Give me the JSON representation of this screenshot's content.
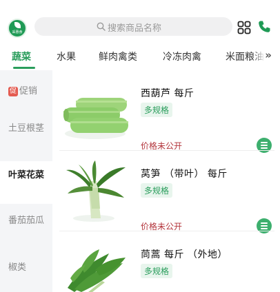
{
  "header": {
    "logo_text": "采惠食",
    "search_placeholder": "搜索商品名称",
    "icons": [
      "scan-grid-icon",
      "phone-icon",
      "search-icon"
    ]
  },
  "tabs": [
    {
      "label": "蔬菜",
      "active": true
    },
    {
      "label": "水果",
      "active": false
    },
    {
      "label": "鲜肉禽类",
      "active": false
    },
    {
      "label": "冷冻肉禽",
      "active": false
    },
    {
      "label": "米面粮油",
      "active": false
    }
  ],
  "tabs_more": "»",
  "sidebar": {
    "promo_badge": "促",
    "items": [
      {
        "label": "促销",
        "active": false
      },
      {
        "label": "土豆根茎",
        "active": false
      },
      {
        "label": "叶菜花菜",
        "active": true
      },
      {
        "label": "番茄茄瓜",
        "active": false
      },
      {
        "label": "椒类",
        "active": false
      }
    ]
  },
  "products": [
    {
      "name": "西葫芦 每斤",
      "spec": "多规格",
      "price": "价格未公开",
      "image": "zucchini"
    },
    {
      "name": "莴笋 （带叶） 每斤",
      "spec": "多规格",
      "price": "价格未公开",
      "image": "celtuce"
    },
    {
      "name": "茼蒿 每斤 （外地）",
      "spec": "多规格",
      "price": "",
      "image": "crown-daisy"
    }
  ],
  "colors": {
    "accent": "#2a9d5c",
    "price": "#b3343b",
    "promo": "#e45c52",
    "sidebar_bg": "#f4f5f7"
  }
}
